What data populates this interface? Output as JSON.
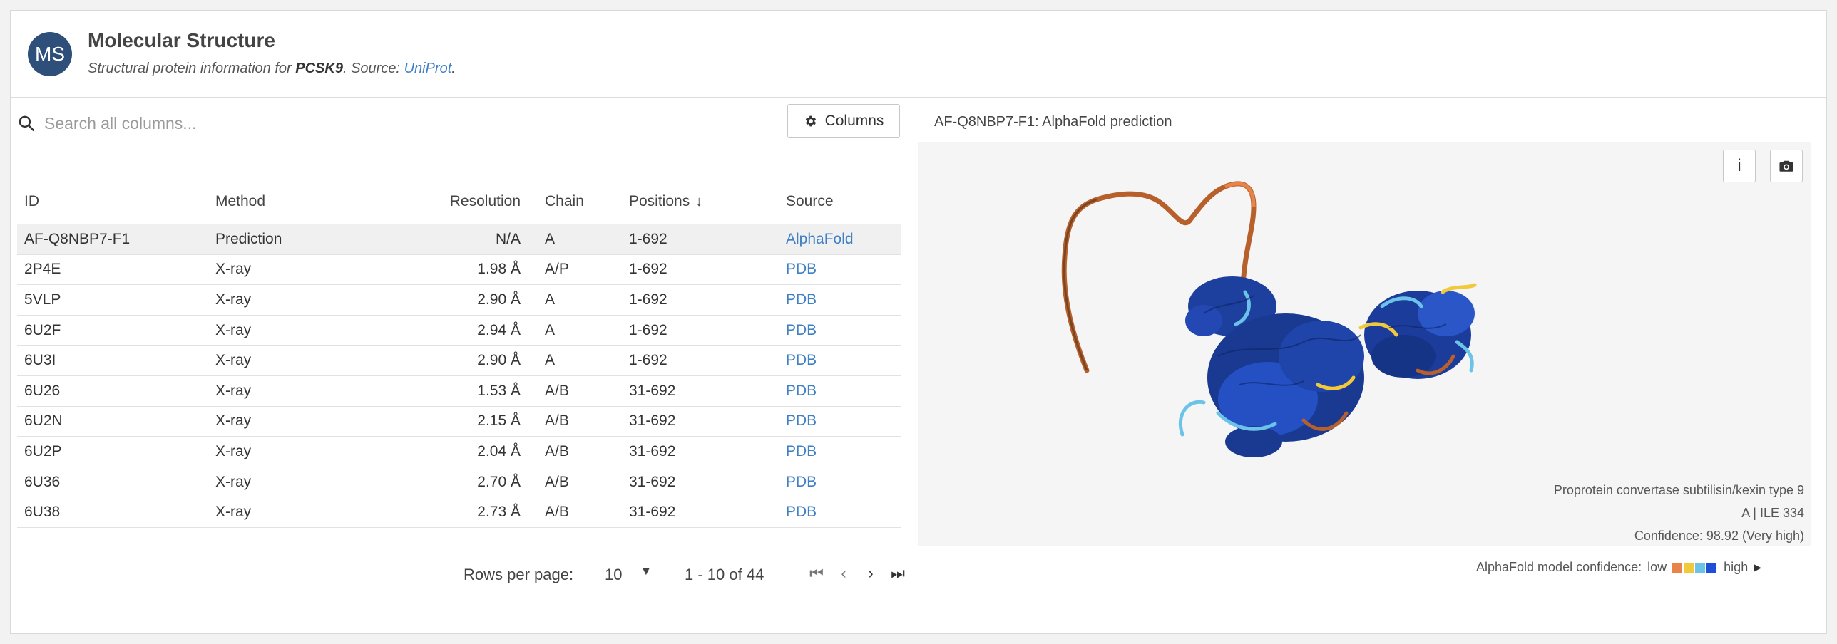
{
  "header": {
    "avatar": "MS",
    "title": "Molecular Structure",
    "subtitle_prefix": "Structural protein information for",
    "gene": "PCSK9",
    "source_prefix": ". Source:",
    "source_link": "UniProt",
    "source_suffix": "."
  },
  "search": {
    "placeholder": "Search all columns..."
  },
  "columns_button": "Columns",
  "table": {
    "headers": {
      "id": "ID",
      "method": "Method",
      "resolution": "Resolution",
      "chain": "Chain",
      "positions": "Positions",
      "source": "Source"
    },
    "rows": [
      {
        "id": "AF-Q8NBP7-F1",
        "method": "Prediction",
        "resolution": "N/A",
        "chain": "A",
        "positions": "1-692",
        "source": "AlphaFold"
      },
      {
        "id": "2P4E",
        "method": "X-ray",
        "resolution": "1.98 Å",
        "chain": "A/P",
        "positions": "1-692",
        "source": "PDB"
      },
      {
        "id": "5VLP",
        "method": "X-ray",
        "resolution": "2.90 Å",
        "chain": "A",
        "positions": "1-692",
        "source": "PDB"
      },
      {
        "id": "6U2F",
        "method": "X-ray",
        "resolution": "2.94 Å",
        "chain": "A",
        "positions": "1-692",
        "source": "PDB"
      },
      {
        "id": "6U3I",
        "method": "X-ray",
        "resolution": "2.90 Å",
        "chain": "A",
        "positions": "1-692",
        "source": "PDB"
      },
      {
        "id": "6U26",
        "method": "X-ray",
        "resolution": "1.53 Å",
        "chain": "A/B",
        "positions": "31-692",
        "source": "PDB"
      },
      {
        "id": "6U2N",
        "method": "X-ray",
        "resolution": "2.15 Å",
        "chain": "A/B",
        "positions": "31-692",
        "source": "PDB"
      },
      {
        "id": "6U2P",
        "method": "X-ray",
        "resolution": "2.04 Å",
        "chain": "A/B",
        "positions": "31-692",
        "source": "PDB"
      },
      {
        "id": "6U36",
        "method": "X-ray",
        "resolution": "2.70 Å",
        "chain": "A/B",
        "positions": "31-692",
        "source": "PDB"
      },
      {
        "id": "6U38",
        "method": "X-ray",
        "resolution": "2.73 Å",
        "chain": "A/B",
        "positions": "31-692",
        "source": "PDB"
      }
    ]
  },
  "pagination": {
    "rows_per_page_label": "Rows per page:",
    "rows_per_page": "10",
    "range": "1 - 10 of 44"
  },
  "viewer": {
    "title_id": "AF-Q8NBP7-F1:",
    "title_rest": " AlphaFold prediction",
    "info_button": "i",
    "protein_name": "Proprotein convertase subtilisin/kexin type 9",
    "residue": "A | ILE 334",
    "confidence": "Confidence: 98.92 (Very high)"
  },
  "legend": {
    "label": "AlphaFold model confidence:",
    "low": "low",
    "high": "high",
    "colors": [
      "#e8834a",
      "#f3c93c",
      "#6cc3e8",
      "#1f4fd6"
    ]
  }
}
